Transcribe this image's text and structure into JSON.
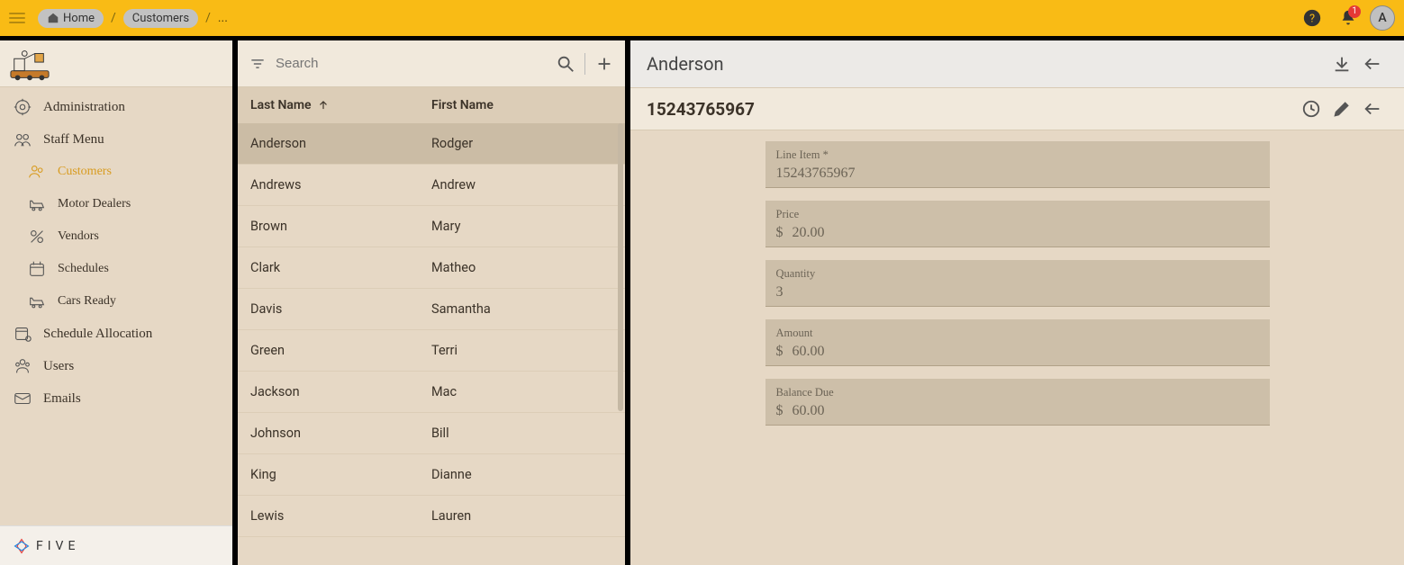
{
  "breadcrumb": {
    "home": "Home",
    "customers": "Customers",
    "ellipsis": "..."
  },
  "notifications": {
    "count": "1"
  },
  "avatar": {
    "initial": "A"
  },
  "sidebar": {
    "items": [
      {
        "label": "Administration",
        "sub": false
      },
      {
        "label": "Staff Menu",
        "sub": false
      },
      {
        "label": "Customers",
        "sub": true,
        "active": true
      },
      {
        "label": "Motor Dealers",
        "sub": true
      },
      {
        "label": "Vendors",
        "sub": true
      },
      {
        "label": "Schedules",
        "sub": true
      },
      {
        "label": "Cars Ready",
        "sub": true
      },
      {
        "label": "Schedule Allocation",
        "sub": false
      },
      {
        "label": "Users",
        "sub": false
      },
      {
        "label": "Emails",
        "sub": false
      }
    ],
    "footer_brand": "FIVE"
  },
  "list": {
    "search_placeholder": "Search",
    "columns": {
      "last": "Last Name",
      "first": "First Name"
    },
    "rows": [
      {
        "last": "Anderson",
        "first": "Rodger",
        "selected": true
      },
      {
        "last": "Andrews",
        "first": "Andrew"
      },
      {
        "last": "Brown",
        "first": "Mary"
      },
      {
        "last": "Clark",
        "first": "Matheo"
      },
      {
        "last": "Davis",
        "first": "Samantha"
      },
      {
        "last": "Green",
        "first": "Terri"
      },
      {
        "last": "Jackson",
        "first": "Mac"
      },
      {
        "last": "Johnson",
        "first": "Bill"
      },
      {
        "last": "King",
        "first": "Dianne"
      },
      {
        "last": "Lewis",
        "first": "Lauren"
      }
    ]
  },
  "detail": {
    "title": "Anderson",
    "subtitle": "15243765967",
    "fields": [
      {
        "label": "Line Item *",
        "value": "15243765967",
        "currency": false
      },
      {
        "label": "Price",
        "value": "20.00",
        "currency": true
      },
      {
        "label": "Quantity",
        "value": "3",
        "currency": false
      },
      {
        "label": "Amount",
        "value": "60.00",
        "currency": true
      },
      {
        "label": "Balance Due",
        "value": "60.00",
        "currency": true
      }
    ]
  }
}
